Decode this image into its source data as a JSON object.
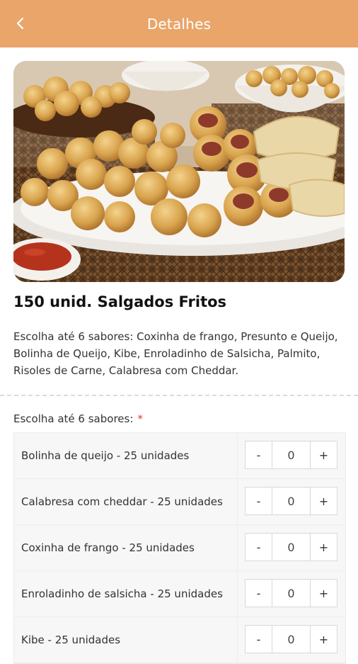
{
  "header": {
    "title": "Detalhes",
    "back_icon": "chevron-left-icon"
  },
  "product": {
    "name": "150 unid. Salgados Fritos",
    "description": "Escolha até 6 sabores: Coxinha de frango, Presunto e Queijo, Bolinha de Queijo, Kibe, Enroladinho de Salsicha, Palmito, Risoles de Carne, Calabresa com Cheddar."
  },
  "selection": {
    "label": "Escolha até 6 sabores:",
    "required_mark": "*",
    "options": [
      {
        "label": "Bolinha de queijo - 25 unidades",
        "minus": "-",
        "value": "0",
        "plus": "+"
      },
      {
        "label": "Calabresa com cheddar - 25 unidades",
        "minus": "-",
        "value": "0",
        "plus": "+"
      },
      {
        "label": "Coxinha de frango - 25 unidades",
        "minus": "-",
        "value": "0",
        "plus": "+"
      },
      {
        "label": "Enroladinho de salsicha - 25 unidades",
        "minus": "-",
        "value": "0",
        "plus": "+"
      },
      {
        "label": "Kibe - 25 unidades",
        "minus": "-",
        "value": "0",
        "plus": "+"
      }
    ]
  },
  "colors": {
    "header": "#e9a56a",
    "required": "#e53935"
  }
}
